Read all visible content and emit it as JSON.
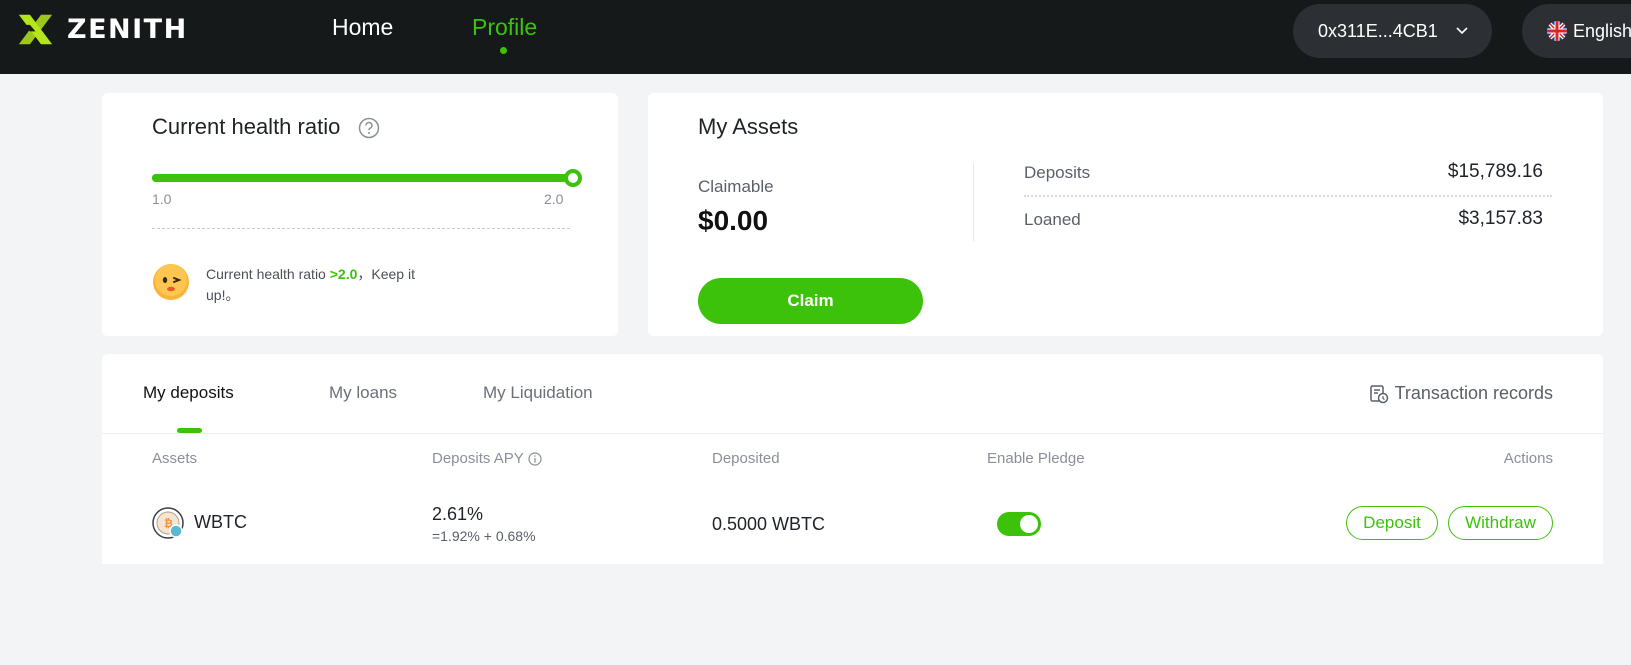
{
  "nav": {
    "brand": "ZENITH",
    "links": [
      {
        "label": "Home",
        "active": false
      },
      {
        "label": "Profile",
        "active": true
      }
    ],
    "wallet_address": "0x311E...4CB1",
    "language": "English"
  },
  "health": {
    "title": "Current health ratio",
    "min_label": "1.0",
    "max_label": "2.0",
    "ratio_fill": 1.0,
    "message_prefix": "Current health ratio ",
    "message_highlight": ">2.0",
    "message_suffix": "，Keep it up!。"
  },
  "assets": {
    "title": "My Assets",
    "claimable_label": "Claimable",
    "claimable_value": "$0.00",
    "claim_button": "Claim",
    "rows": [
      {
        "label": "Deposits",
        "value": "$15,789.16"
      },
      {
        "label": "Loaned",
        "value": "$3,157.83"
      }
    ]
  },
  "tabs": {
    "items": [
      "My deposits",
      "My loans",
      "My Liquidation"
    ],
    "active": "My deposits",
    "transaction_records": "Transaction records"
  },
  "table": {
    "headers": [
      "Assets",
      "Deposits APY",
      "Deposited",
      "Enable Pledge",
      "Actions"
    ],
    "rows": [
      {
        "asset": "WBTC",
        "apy": "2.61%",
        "apy_breakdown": "=1.92% + 0.68%",
        "deposited": "0.5000 WBTC",
        "pledge_enabled": true,
        "actions": [
          "Deposit",
          "Withdraw"
        ]
      }
    ]
  },
  "colors": {
    "accent": "#3cc20a",
    "topbar": "#16191a",
    "background": "#f3f4f6"
  }
}
